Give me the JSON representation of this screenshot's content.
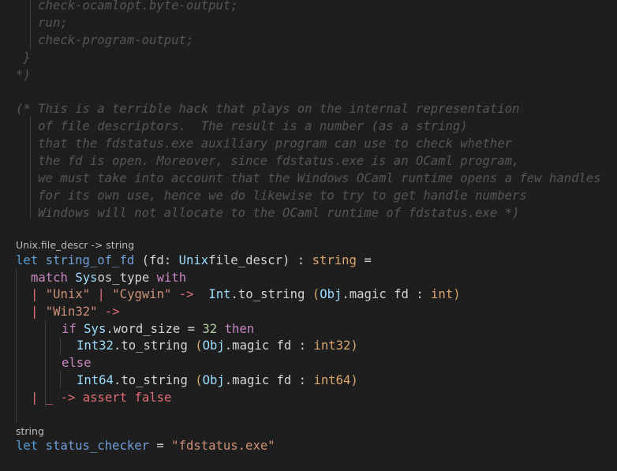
{
  "header_comment": {
    "lines": [
      "   check-ocamlopt.byte-output;",
      "   run;",
      "   check-program-output;",
      " }",
      "*)"
    ]
  },
  "doc_comment": {
    "lines": [
      "(* This is a terrible hack that plays on the internal representation",
      "   of file descriptors.  The result is a number (as a string)",
      "   that the fdstatus.exe auxiliary program can use to check whether",
      "   the fd is open. Moreover, since fdstatus.exe is an OCaml program,",
      "   we must take into account that the Windows OCaml runtime opens a few handles",
      "   for its own use, hence we do likewise to try to get handle numbers",
      "   Windows will not allocate to the OCaml runtime of fdstatus.exe *)"
    ]
  },
  "hint1": "Unix.file_descr -> string",
  "hint2": "string",
  "code": {
    "l1": {
      "let": "let",
      "name": "string_of_fd",
      "p1": " (",
      "param": "fd",
      ":": ": ",
      "mod": "Unix",
      ".": ".",
      "type": "file_descr",
      ")": ") : ",
      "ret": "string",
      "eq": " ="
    },
    "l2": {
      "match": "match",
      "mod": "Sys",
      ".": ".",
      "field": "os_type",
      "with": "with"
    },
    "l3": {
      "bar": "|",
      "s1": "\"Unix\"",
      "bar2": "|",
      "s2": "\"Cygwin\"",
      "arrow": "->",
      "mod": "Int",
      "fn": ".to_string",
      "p": " (",
      "mod2": "Obj",
      "fn2": ".magic fd : ",
      "ty": "int",
      ")": ")"
    },
    "l4": {
      "bar": "|",
      "s": "\"Win32\"",
      "arrow": "->"
    },
    "l5": {
      "if": "if",
      "mod": "Sys",
      "field": ".word_size",
      "eq": " = ",
      "num": "32",
      "then": "then"
    },
    "l6": {
      "mod": "Int32",
      "fn": ".to_string",
      "p": " (",
      "mod2": "Obj",
      "fn2": ".magic fd : ",
      "ty": "int32",
      ")": ")"
    },
    "l7": {
      "else": "else"
    },
    "l8": {
      "mod": "Int64",
      "fn": ".to_string",
      "p": " (",
      "mod2": "Obj",
      "fn2": ".magic fd : ",
      "ty": "int64",
      ")": ")"
    },
    "l9": {
      "bar": "|",
      "wild": "_",
      "arrow": "->",
      "assert": "assert",
      "false": "false"
    },
    "l10": {
      "let": "let",
      "name": "status_checker",
      "eq": " = ",
      "str": "\"fdstatus.exe\""
    }
  }
}
